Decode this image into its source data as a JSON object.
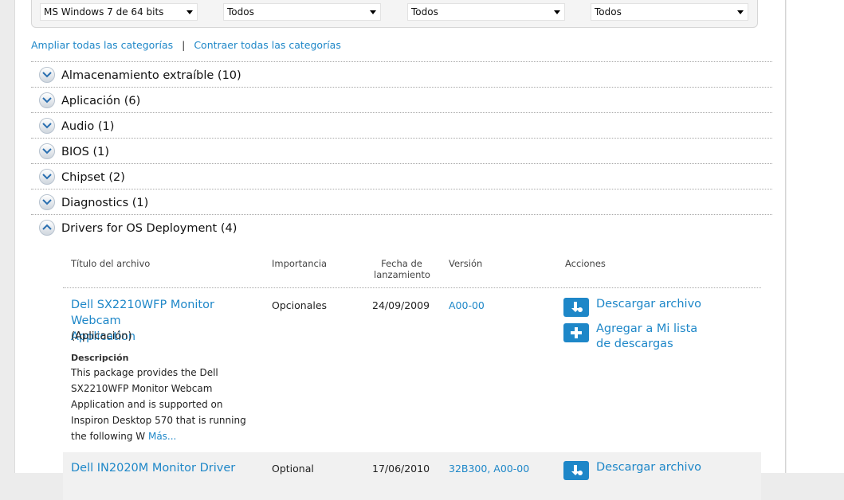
{
  "filters": {
    "os": "MS Windows 7 de 64 bits",
    "filter2": "Todos",
    "filter3": "Todos",
    "filter4": "Todos"
  },
  "toggles": {
    "expand_all": "Ampliar todas las categorías",
    "separator": "|",
    "collapse_all": "Contraer todas las categorías"
  },
  "categories": [
    {
      "label": "Almacenamiento extraíble (10)"
    },
    {
      "label": "Aplicación (6)"
    },
    {
      "label": "Audio (1)"
    },
    {
      "label": "BIOS (1)"
    },
    {
      "label": "Chipset (2)"
    },
    {
      "label": "Diagnostics (1)"
    },
    {
      "label": "Drivers for OS Deployment (4)"
    }
  ],
  "table": {
    "headers": {
      "title": "Título del archivo",
      "importance": "Importancia",
      "date_line1": "Fecha de",
      "date_line2": "lanzamiento",
      "version": "Versión",
      "actions": "Acciones"
    },
    "rows": [
      {
        "title_line1": "Dell SX2210WFP Monitor Webcam",
        "title_line2": "Application",
        "category": "(Aplicación)",
        "desc_label": "Descripción",
        "desc_lines": [
          "This package provides the Dell",
          "SX2210WFP Monitor Webcam",
          "Application and is supported on",
          "Inspiron Desktop 570 that is running",
          "the following W"
        ],
        "more": "Más...",
        "importance": "Opcionales",
        "date": "24/09/2009",
        "version": "A00-00",
        "download": "Descargar archivo",
        "add_line1": "Agregar a Mi lista",
        "add_line2": "de descargas"
      },
      {
        "title_line1": "Dell IN2020M Monitor Driver",
        "importance": "Optional",
        "date": "17/06/2010",
        "version": "32B300, A00-00",
        "download": "Descargar archivo"
      }
    ]
  }
}
